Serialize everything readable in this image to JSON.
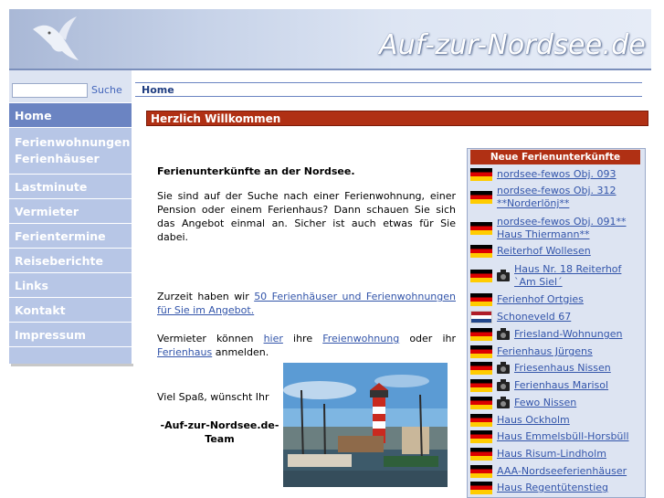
{
  "header": {
    "site_title": "Auf-zur-Nordsee.de"
  },
  "search": {
    "placeholder": "",
    "button_label": "Suche"
  },
  "nav": [
    {
      "label": "Home"
    },
    {
      "label": "Ferienwohnungen Ferienhäuser"
    },
    {
      "label": "Lastminute"
    },
    {
      "label": "Vermieter"
    },
    {
      "label": "Ferientermine"
    },
    {
      "label": "Reiseberichte"
    },
    {
      "label": "Links"
    },
    {
      "label": "Kontakt"
    },
    {
      "label": "Impressum"
    }
  ],
  "breadcrumb": "Home",
  "welcome_title": "Herzlich Willkommen",
  "content": {
    "heading": "Ferienunterkünfte an der Nordsee.",
    "intro": "Sie sind auf der Suche nach einer Ferienwohnung, einer Pension oder einem Ferienhaus? Dann schauen Sie sich das Angebot einmal an. Sicher ist auch etwas für Sie dabei.",
    "count_prefix": "Zurzeit haben wir ",
    "count_link": "50 Ferienhäuser und Ferienwohnungen für Sie im Angebot.",
    "landlord_prefix": "Vermieter können ",
    "landlord_link_here": "hier",
    "landlord_middle1": " ihre ",
    "landlord_link_fewo": "Freienwohnung",
    "landlord_middle2": " oder ihr ",
    "landlord_link_haus": "Ferienhaus",
    "landlord_suffix": " anmelden.",
    "farewell": "Viel Spaß, wünscht Ihr",
    "team_line1": "-Auf-zur-Nordsee.de-",
    "team_line2": "Team"
  },
  "new_listings": {
    "title": "Neue Ferienunterkünfte",
    "items": [
      {
        "label": "nordsee-fewos Obj. 093",
        "flag": "de",
        "camera": false
      },
      {
        "label": "nordsee-fewos Obj. 312 **Norderlönj**",
        "flag": "de",
        "camera": false
      },
      {
        "label": "nordsee-fewos Obj. 091** Haus Thiermann**",
        "flag": "de",
        "camera": false
      },
      {
        "label": "Reiterhof Wollesen",
        "flag": "de",
        "camera": false
      },
      {
        "label": "Haus Nr. 18 Reiterhof `Am Siel´",
        "flag": "de",
        "camera": true
      },
      {
        "label": "Ferienhof Ortgies",
        "flag": "de",
        "camera": false
      },
      {
        "label": "Schoneveld 67",
        "flag": "nl",
        "camera": false
      },
      {
        "label": "Friesland-Wohnungen",
        "flag": "de",
        "camera": true
      },
      {
        "label": "Ferienhaus Jürgens",
        "flag": "de",
        "camera": false
      },
      {
        "label": "Friesenhaus Nissen",
        "flag": "de",
        "camera": true
      },
      {
        "label": "Ferienhaus Marisol",
        "flag": "de",
        "camera": true
      },
      {
        "label": "Fewo Nissen",
        "flag": "de",
        "camera": true
      },
      {
        "label": "Haus Ockholm",
        "flag": "de",
        "camera": false
      },
      {
        "label": "Haus Emmelsbüll-Horsbüll",
        "flag": "de",
        "camera": false
      },
      {
        "label": "Haus Risum-Lindholm",
        "flag": "de",
        "camera": false
      },
      {
        "label": "AAA-Nordseeferienhäuser",
        "flag": "de",
        "camera": false
      },
      {
        "label": "Haus Regentütenstieg",
        "flag": "de",
        "camera": false
      }
    ]
  },
  "colors": {
    "accent_red": "#b03014",
    "nav_bg": "#b7c6e6",
    "nav_active": "#6b84c2",
    "link": "#3355aa"
  }
}
